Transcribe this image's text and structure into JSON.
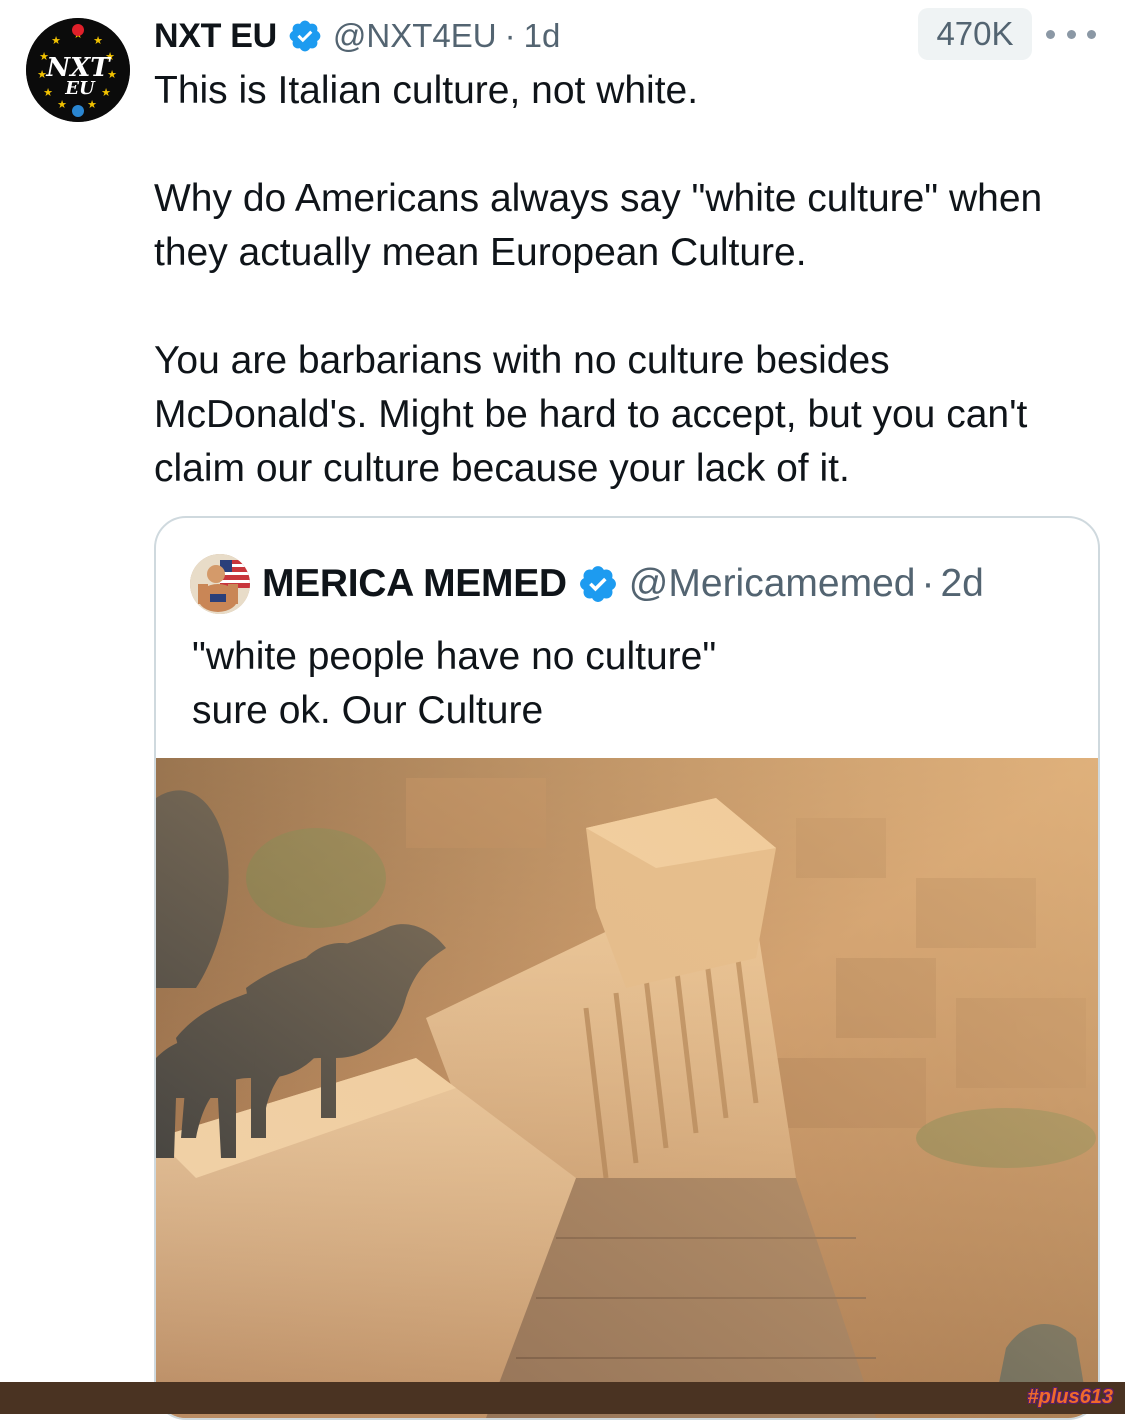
{
  "post": {
    "author_name": "NXT EU",
    "author_handle": "@NXT4EU",
    "separator": "·",
    "time": "1d",
    "views": "470K",
    "avatar_logo_text": "NXT EU",
    "text_paragraphs": [
      "This is Italian culture, not white.",
      "Why do Americans always say \"white culture\" when they actually mean European Culture.",
      "You are barbarians with no culture besides McDonald's. Might be hard to accept, but you can't claim our culture because your lack of it."
    ]
  },
  "quoted_post": {
    "author_name": "MERICA MEMED",
    "author_handle": "@Mericamemed",
    "separator": "·",
    "time": "2d",
    "text_lines": [
      "\"white people have no culture\"",
      "sure ok. Our Culture"
    ]
  },
  "watermark": "#plus613",
  "icons": {
    "verified": "verified-badge-icon",
    "more": "more-options-icon"
  },
  "colors": {
    "verified_blue": "#1d9bf0",
    "secondary_text": "#536471",
    "border": "#cfd9de"
  }
}
